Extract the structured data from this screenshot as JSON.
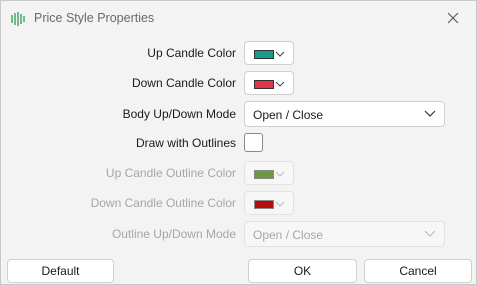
{
  "window": {
    "title": "Price Style Properties",
    "app_icon": "candlestick-chart-icon",
    "close_icon": "close-icon"
  },
  "form": {
    "up_candle_color": {
      "label": "Up Candle Color",
      "color": "#169c8c",
      "icon": "chevron-down-icon"
    },
    "down_candle_color": {
      "label": "Down Candle Color",
      "color": "#e0374c",
      "icon": "chevron-down-icon"
    },
    "body_mode": {
      "label": "Body Up/Down Mode",
      "value": "Open / Close",
      "icon": "chevron-down-icon"
    },
    "draw_outlines": {
      "label": "Draw with Outlines",
      "checked": false
    },
    "up_outline_color": {
      "label": "Up Candle Outline Color",
      "color": "#6a9a3a",
      "disabled": true
    },
    "down_outline_color": {
      "label": "Down Candle Outline Color",
      "color": "#b50d0d",
      "disabled": true
    },
    "outline_mode": {
      "label": "Outline Up/Down Mode",
      "value": "Open / Close",
      "disabled": true
    }
  },
  "buttons": {
    "default": "Default",
    "ok": "OK",
    "cancel": "Cancel"
  },
  "colors": {
    "chart_up": "#4caf50",
    "chart_down": "#d9534f",
    "dialog_bg": "#f3f3f3"
  }
}
